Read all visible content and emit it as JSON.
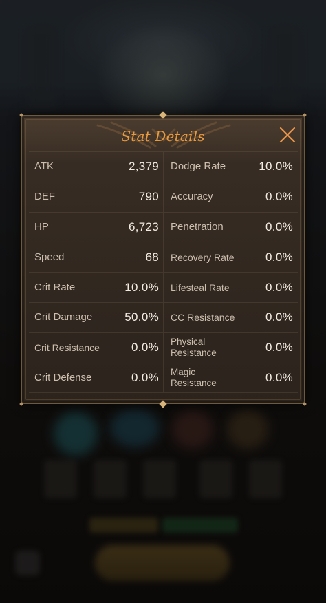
{
  "dialog": {
    "title": "Stat Details",
    "close_icon": "close-icon",
    "accent_color": "#e89a3e"
  },
  "stats": {
    "left": [
      {
        "label": "ATK",
        "value": "2,379"
      },
      {
        "label": "DEF",
        "value": "790"
      },
      {
        "label": "HP",
        "value": "6,723"
      },
      {
        "label": "Speed",
        "value": "68"
      },
      {
        "label": "Crit Rate",
        "value": "10.0%"
      },
      {
        "label": "Crit Damage",
        "value": "50.0%"
      },
      {
        "label": "Crit Resistance",
        "value": "0.0%"
      },
      {
        "label": "Crit Defense",
        "value": "0.0%"
      }
    ],
    "right": [
      {
        "label": "Dodge Rate",
        "value": "10.0%"
      },
      {
        "label": "Accuracy",
        "value": "0.0%"
      },
      {
        "label": "Penetration",
        "value": "0.0%"
      },
      {
        "label": "Recovery Rate",
        "value": "0.0%"
      },
      {
        "label": "Lifesteal Rate",
        "value": "0.0%"
      },
      {
        "label": "CC Resistance",
        "value": "0.0%"
      },
      {
        "label": "Physical Resistance",
        "value": "0.0%"
      },
      {
        "label": "Magic Resistance",
        "value": "0.0%"
      }
    ]
  }
}
